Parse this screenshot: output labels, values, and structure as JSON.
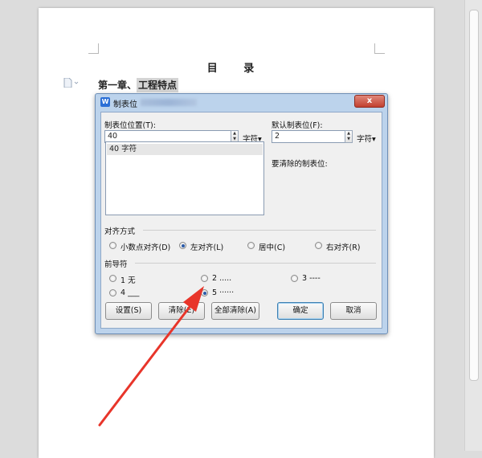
{
  "document": {
    "title": "目 录",
    "heading_prefix": "第一章、",
    "heading_highlight": "工程特点"
  },
  "dialog": {
    "title": "制表位",
    "app_icon_glyph": "W",
    "close_glyph": "x",
    "tab_position": {
      "label": "制表位位置(T):",
      "value": "40",
      "unit": "字符▾",
      "list_items": [
        "40 字符"
      ]
    },
    "default_tab": {
      "label": "默认制表位(F):",
      "value": "2",
      "unit": "字符▾"
    },
    "clear_label": "要清除的制表位:",
    "alignment": {
      "group_label": "对齐方式",
      "options": [
        {
          "label": "小数点对齐(D)",
          "selected": false
        },
        {
          "label": "左对齐(L)",
          "selected": true
        },
        {
          "label": "居中(C)",
          "selected": false
        },
        {
          "label": "右对齐(R)",
          "selected": false
        }
      ]
    },
    "leader": {
      "group_label": "前导符",
      "options": [
        {
          "label": "1 无",
          "selected": false
        },
        {
          "label": "2 .....",
          "selected": false
        },
        {
          "label": "3 ----",
          "selected": false
        },
        {
          "label": "4 ___",
          "selected": false
        },
        {
          "label": "5 ······",
          "selected": true
        }
      ]
    },
    "buttons": {
      "set": "设置(S)",
      "clear": "清除(E)",
      "clear_all": "全部清除(A)",
      "ok": "确定",
      "cancel": "取消"
    }
  },
  "colors": {
    "annotation_arrow": "#e8352a",
    "dialog_frame": "#bcd3ec",
    "radio_dot": "#2a5aa8"
  },
  "icons": {
    "doc_marker": "document-icon",
    "spin": "spin-arrows-icon"
  }
}
